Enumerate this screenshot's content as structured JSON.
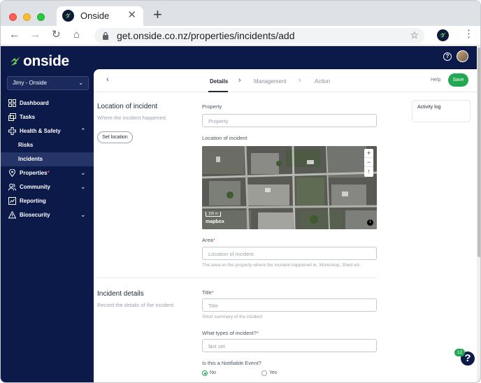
{
  "browser": {
    "tab_title": "Onside",
    "tab_close": "✕",
    "new_tab": "+",
    "url": "get.onside.co.nz/properties/incidents/add",
    "back": "←",
    "forward": "→",
    "reload": "↻",
    "home": "⌂",
    "bookmark": "☆",
    "menu": "⋮"
  },
  "app": {
    "logo_text": "onside",
    "help_glyph": "?",
    "accent": "#22a754",
    "navy": "#0c1a4a"
  },
  "sidebar": {
    "org": "Jimy - Onside",
    "org_chevron": "⌄",
    "items": [
      {
        "label": "Dashboard",
        "icon": "dashboard-icon"
      },
      {
        "label": "Tasks",
        "icon": "tasks-icon"
      },
      {
        "label": "Health & Safety",
        "icon": "health-safety-icon",
        "chevron": "⌃"
      },
      {
        "label": "Risks"
      },
      {
        "label": "Incidents"
      },
      {
        "label": "Properties",
        "required": "*",
        "icon": "properties-icon",
        "chevron": "⌄"
      },
      {
        "label": "Community",
        "icon": "community-icon",
        "chevron": "⌄"
      },
      {
        "label": "Reporting",
        "icon": "reporting-icon"
      },
      {
        "label": "Biosecurity",
        "icon": "biosecurity-icon",
        "chevron": "⌄"
      }
    ]
  },
  "wizard": {
    "back": "‹",
    "steps": [
      "Details",
      "Management",
      "Action"
    ],
    "separator": "›",
    "help": "Help",
    "save": "Save"
  },
  "location_section": {
    "title": "Location of incident",
    "desc": "Where the incident happened",
    "set_location": "Set location"
  },
  "fields": {
    "property_label": "Property",
    "property_placeholder": "Property",
    "location_label": "Location of incident",
    "area_label": "Area",
    "area_req": "*",
    "area_placeholder": "Location of incident",
    "area_help": "The area on the property where the incident happened ie. Workshop, Shed etc.",
    "title_label": "Title",
    "title_req": "*",
    "title_placeholder": "Title",
    "title_help": "Short summary of the incident",
    "types_label": "What types of incident?",
    "types_req": "*",
    "types_value": "Not set",
    "notifiable_label": "Is this a Notifiable Event?",
    "no": "No",
    "yes": "Yes"
  },
  "details_section": {
    "title": "Incident details",
    "desc": "Record the details of the incident."
  },
  "activity_log": "Activity log",
  "map": {
    "zoom_in": "+",
    "zoom_out": "−",
    "compass": "↑",
    "logo": "mapbox",
    "info": "i",
    "scale": "100 m"
  },
  "help_widget": {
    "badge": "12",
    "glyph": "?"
  }
}
